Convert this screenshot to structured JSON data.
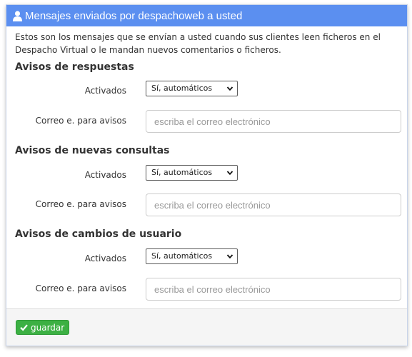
{
  "panel": {
    "title": "Mensajes enviados por despachoweb a usted",
    "intro": "Estos son los mensajes que se envían a usted cuando sus clientes leen ficheros en el Despacho Virtual o le mandan nuevos comentarios o ficheros."
  },
  "sections": [
    {
      "title": "Avisos de respuestas",
      "enabled_label": "Activados",
      "enabled_value": "Sí, automáticos",
      "email_label": "Correo e. para avisos",
      "email_placeholder": "escriba el correo electrónico",
      "email_value": ""
    },
    {
      "title": "Avisos de nuevas consultas",
      "enabled_label": "Activados",
      "enabled_value": "Sí, automáticos",
      "email_label": "Correo e. para avisos",
      "email_placeholder": "escriba el correo electrónico",
      "email_value": ""
    },
    {
      "title": "Avisos de cambios de usuario",
      "enabled_label": "Activados",
      "enabled_value": "Sí, automáticos",
      "email_label": "Correo e. para avisos",
      "email_placeholder": "escriba el correo electrónico",
      "email_value": ""
    }
  ],
  "footer": {
    "save_label": "guardar"
  },
  "colors": {
    "header": "#5b8ff0",
    "save_button": "#3cb043"
  },
  "icons": {
    "header": "user-icon",
    "save": "check-icon",
    "select": "chevron-down-icon"
  }
}
